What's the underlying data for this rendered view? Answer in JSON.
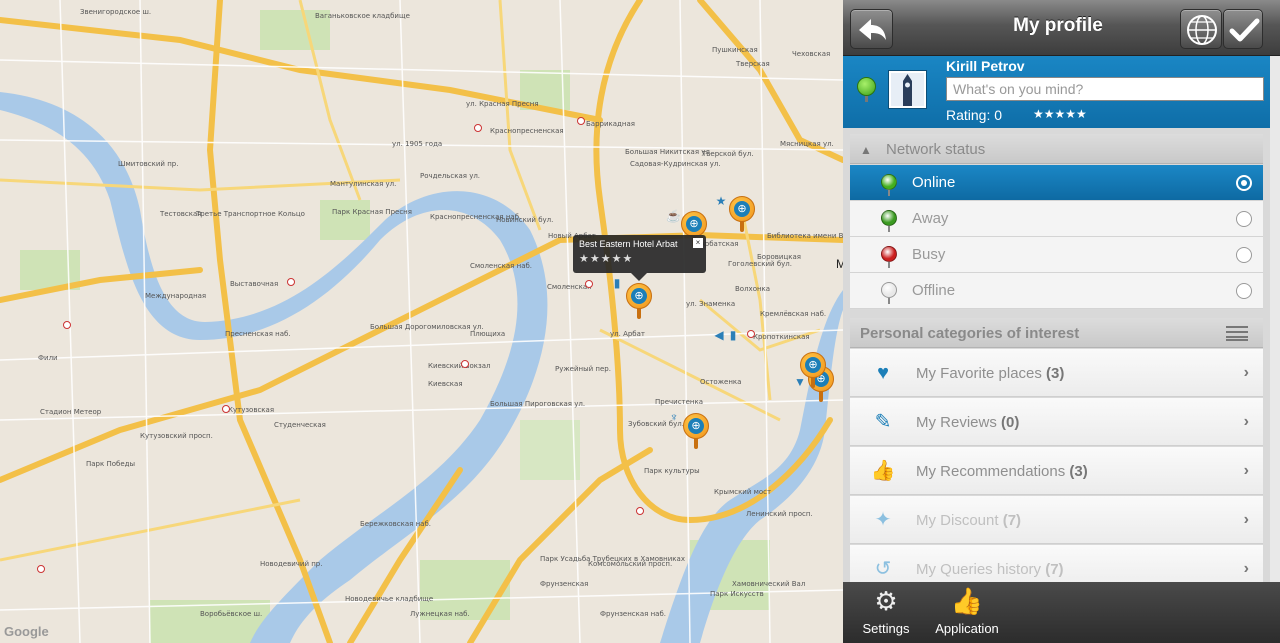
{
  "map": {
    "popup": {
      "title": "Best Eastern Hotel Arbat",
      "stars": "★★★★★",
      "close": "×"
    },
    "logo": "Google",
    "edge_letter": "M",
    "street_labels": [
      "Звенигородское ш.",
      "Ваганьковское кладбище",
      "Краснопресненская",
      "Баррикадная",
      "Большая Никитская ул.",
      "Новый Арбат",
      "Смоленская",
      "Кропоткинская",
      "Киевский вокзал",
      "Кутузовская",
      "Студенческая",
      "Выставочная",
      "Международная",
      "Тестовская",
      "Парк Победы",
      "Фили",
      "Стадион Метеор",
      "Парк Красная Пресня",
      "Пречистенка",
      "Остоженка",
      "Фрунзенская",
      "Парк культуры",
      "Крымский мост",
      "Парк Искусств",
      "Новодевичье кладбище",
      "Киевская",
      "Арбатская",
      "Боровицкая",
      "Библиотека имени В. И. Ленина",
      "Тверская",
      "Пушкинская",
      "Чеховская",
      "Садовая-Кудринская ул.",
      "Третье Транспортное Кольцо",
      "Бережковская наб.",
      "Большая Дорогомиловская ул.",
      "Кутузовский просп.",
      "Смоленская наб.",
      "Тверской бул.",
      "Гоголевский бул.",
      "Зубовский бул.",
      "Комсомольский просп.",
      "ул. Арбат",
      "Лужнецкая наб.",
      "Воробьёвское ш.",
      "Фрунзенская наб.",
      "Парк Усадьба Трубецких в Хамовниках",
      "Новодевичий пр.",
      "Ленинский просп.",
      "Пресненская наб.",
      "ул. 1905 года",
      "Шмитовский пр.",
      "ул. Красная Пресня",
      "Мантулинская ул.",
      "Рочдельская ул.",
      "Краснопресненская наб.",
      "Новинский бул.",
      "Плющиха",
      "Ружейный пер.",
      "Большая Пироговская ул.",
      "Хамовнический Вал",
      "Кремлёвская наб.",
      "ул. Знаменка",
      "Волхонка",
      "Мясницкая ул."
    ]
  },
  "topbar": {
    "title": "My profile",
    "back_icon": "back-arrow-icon",
    "globe_icon": "globe-icon",
    "check_icon": "check-icon"
  },
  "profile": {
    "name": "Kirill Petrov",
    "mind_placeholder": "What's on you mind?",
    "rating_label": "Rating: 0",
    "rating_stars": "★★★★★"
  },
  "network": {
    "header": "Network status",
    "statuses": [
      {
        "label": "Online",
        "color": "#44b01e",
        "selected": true
      },
      {
        "label": "Away",
        "color": "#3a9a20",
        "selected": false
      },
      {
        "label": "Busy",
        "color": "#cc1f1f",
        "selected": false
      },
      {
        "label": "Offline",
        "color": "#e8e8e8",
        "selected": false
      }
    ]
  },
  "categories": {
    "header": "Personal categories of interest",
    "items": [
      {
        "label": "My Favorite places",
        "count": "(3)",
        "icon": "heart-icon"
      },
      {
        "label": "My Reviews",
        "count": "(0)",
        "icon": "edit-icon"
      },
      {
        "label": "My Recommendations",
        "count": "(3)",
        "icon": "thumbs-up-icon"
      },
      {
        "label": "My Discount",
        "count": "(7)",
        "icon": "lightbulb-icon"
      },
      {
        "label": "My Queries history",
        "count": "(7)",
        "icon": "history-icon"
      }
    ]
  },
  "bottombar": {
    "settings_label": "Settings",
    "application_label": "Application"
  },
  "colors": {
    "accent_blue": "#1a86c4",
    "pin_orange": "#f0921a",
    "road_yellow": "#f5c842",
    "river_blue": "#a6c6e8"
  }
}
